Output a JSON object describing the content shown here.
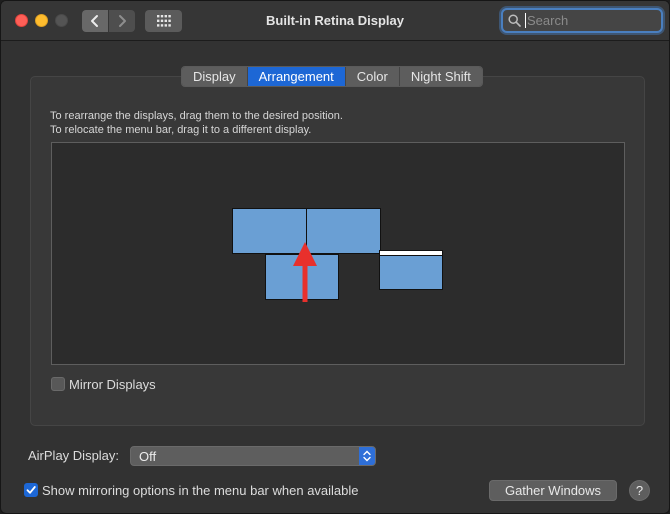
{
  "window": {
    "title": "Built-in Retina Display",
    "search_placeholder": "Search"
  },
  "tabs": [
    {
      "label": "Display",
      "active": false
    },
    {
      "label": "Arrangement",
      "active": true
    },
    {
      "label": "Color",
      "active": false
    },
    {
      "label": "Night Shift",
      "active": false
    }
  ],
  "arrangement": {
    "instruction_line1": "To rearrange the displays, drag them to the desired position.",
    "instruction_line2": "To relocate the menu bar, drag it to a different display.",
    "mirror_label": "Mirror Displays",
    "mirror_checked": false
  },
  "airplay": {
    "label": "AirPlay Display:",
    "value": "Off"
  },
  "mirroring_option": {
    "label": "Show mirroring options in the menu bar when available",
    "checked": true
  },
  "buttons": {
    "gather_windows": "Gather Windows",
    "help": "?"
  },
  "colors": {
    "accent": "#1d67d5",
    "display_fill": "#6a9fd4",
    "arrow": "#e8302c"
  }
}
